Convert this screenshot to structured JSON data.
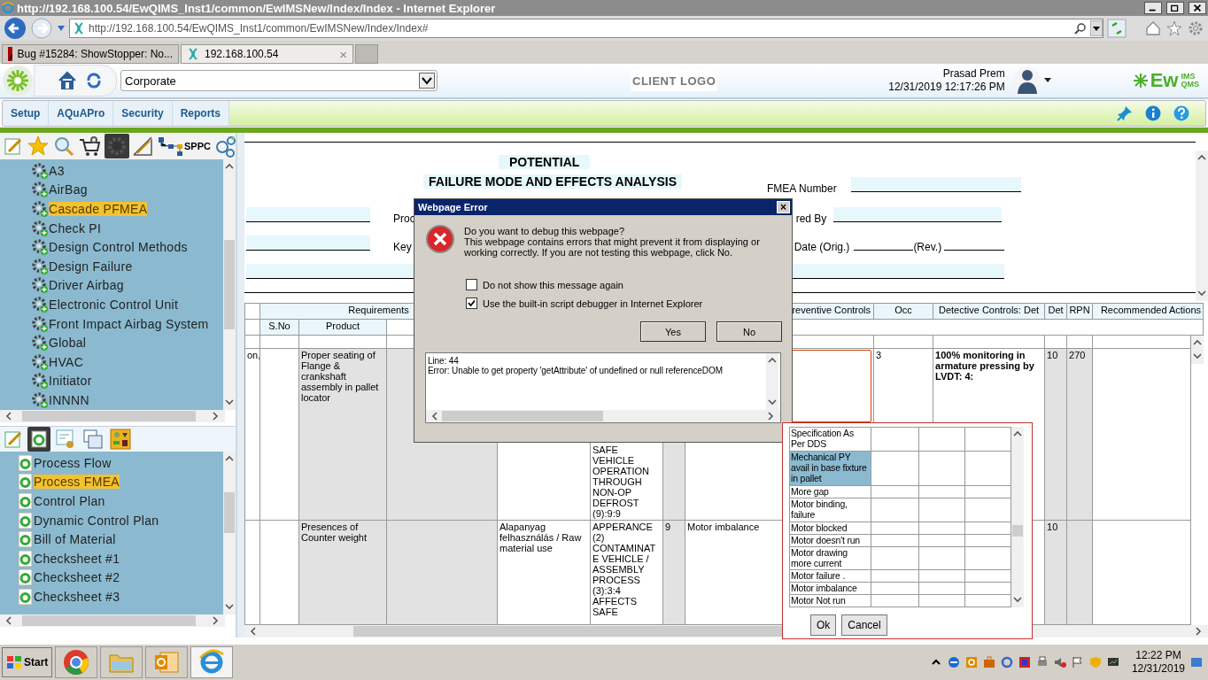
{
  "window": {
    "title": "http://192.168.100.54/EwQIMS_Inst1/common/EwIMSNew/Index/Index - Internet Explorer"
  },
  "address_bar": {
    "value": "http://192.168.100.54/EwQIMS_Inst1/common/EwIMSNew/Index/Index#"
  },
  "browser_tabs": [
    {
      "label": "Bug #15284: ShowStopper: No...",
      "selected": false
    },
    {
      "label": "192.168.100.54",
      "selected": true,
      "close": "×"
    }
  ],
  "app_header": {
    "location": "Corporate",
    "client_logo": "CLIENT LOGO",
    "user_name": "Prasad Prem",
    "datetime": "12/31/2019 12:17:26 PM",
    "brand": "Ew",
    "brand_top": "IMS",
    "brand_bottom": "QMS"
  },
  "menu": [
    {
      "label": "Setup"
    },
    {
      "label": "AQuAPro"
    },
    {
      "label": "Security"
    },
    {
      "label": "Reports"
    }
  ],
  "sidebar": {
    "tools": [
      {
        "kind": "notepad",
        "selected": false
      },
      {
        "kind": "star",
        "selected": false
      },
      {
        "kind": "search",
        "selected": false
      },
      {
        "kind": "cart",
        "selected": false
      },
      {
        "kind": "gear",
        "selected": true
      },
      {
        "kind": "ruler",
        "selected": false
      },
      {
        "kind": "flow",
        "selected": false,
        "label": "SPPC"
      },
      {
        "kind": "circles",
        "selected": false
      }
    ],
    "tree": [
      {
        "label": "A3",
        "selected": false
      },
      {
        "label": "AirBag",
        "selected": false
      },
      {
        "label": "Cascade PFMEA",
        "selected": true
      },
      {
        "label": "Check PI",
        "selected": false
      },
      {
        "label": "Design Control Methods",
        "selected": false
      },
      {
        "label": "Design Failure",
        "selected": false
      },
      {
        "label": "Driver Airbag",
        "selected": false
      },
      {
        "label": "Electronic Control Unit",
        "selected": false
      },
      {
        "label": "Front Impact Airbag System",
        "selected": false
      },
      {
        "label": "Global",
        "selected": false
      },
      {
        "label": "HVAC",
        "selected": false
      },
      {
        "label": "Initiator",
        "selected": false
      },
      {
        "label": "INNNN",
        "selected": false
      }
    ],
    "module_tools": [
      {
        "kind": "notepad",
        "selected": false
      },
      {
        "kind": "document",
        "selected": true
      },
      {
        "kind": "certificate",
        "selected": false
      },
      {
        "kind": "copy",
        "selected": false
      },
      {
        "kind": "diagram",
        "selected": false
      }
    ],
    "modules": [
      {
        "label": "Process Flow",
        "selected": false
      },
      {
        "label": "Process FMEA",
        "selected": true
      },
      {
        "label": "Control Plan",
        "selected": false
      },
      {
        "label": "Dynamic Control Plan",
        "selected": false
      },
      {
        "label": "Bill of Material",
        "selected": false
      },
      {
        "label": "Checksheet #1",
        "selected": false
      },
      {
        "label": "Checksheet #2",
        "selected": false
      },
      {
        "label": "Checksheet #3",
        "selected": false
      }
    ]
  },
  "form": {
    "title_1": "POTENTIAL",
    "title_2": "FAILURE MODE AND EFFECTS ANALYSIS",
    "label_proc": "Proc",
    "label_key": "Key",
    "fmea_number": "FMEA Number",
    "prepared_by": "red By",
    "date_orig": "Date (Orig.)",
    "rev": "(Rev.)"
  },
  "table": {
    "group_header": "Requirements",
    "columns": [
      "reventive Controls",
      "Occ",
      "Detective Controls: Det",
      "Det",
      "RPN",
      "Recommended Actions"
    ],
    "sub_columns": [
      "S.No",
      "Product"
    ],
    "rows": [
      {
        "column_1": "on,",
        "product": "Proper seating of Flange & crankshaft assembly in pallet locator",
        "effect": "SAFE VEHICLE OPERATION THROUGH NON-OP DEFROST (9):9:9",
        "occ": "3",
        "detective": "100% monitoring in armature pressing by LVDT: 4:",
        "det": "10",
        "rpn": "270"
      },
      {
        "product": "Presences of Counter weight",
        "function": "Alapanyag felhasználás / Raw material use",
        "effect": "APPERANCE (2) CONTAMINATE VEHICLE / ASSEMBLY PROCESS (3):3:4 AFFECTS SAFE",
        "sev": "9",
        "cause": "Motor imbalance",
        "det": "10"
      }
    ]
  },
  "dialog": {
    "title": "Webpage Error",
    "close": "×",
    "question": "Do you want to debug this webpage?",
    "message": "This webpage contains errors that might prevent it from displaying or working correctly. If you are not testing this webpage, click No.",
    "options": [
      {
        "label": "Do not show this message again",
        "checked": false
      },
      {
        "label": "Use the built-in script debugger in Internet Explorer",
        "checked": true
      }
    ],
    "buttons": [
      "Yes",
      "No"
    ],
    "details": [
      "Line: 44",
      "Error: Unable to get property 'getAttribute' of undefined or null referenceDOM"
    ]
  },
  "picker": {
    "items": [
      {
        "label": "Specification As Per DDS",
        "selected": false
      },
      {
        "label": "Mechanical PY avail in base fixture in pallet",
        "selected": true
      },
      {
        "label": "More gap",
        "selected": false
      },
      {
        "label": "Motor binding, failure",
        "selected": false
      },
      {
        "label": "Motor blocked",
        "selected": false
      },
      {
        "label": "Motor doesn't run",
        "selected": false
      },
      {
        "label": "Motor drawing more current",
        "selected": false
      },
      {
        "label": "Motor failure .",
        "selected": false
      },
      {
        "label": "Motor imbalance",
        "selected": false
      },
      {
        "label": "Motor Not run",
        "selected": false
      }
    ],
    "buttons": [
      "Ok",
      "Cancel"
    ]
  },
  "taskbar": {
    "start": "Start",
    "time": "12:22 PM",
    "date": "12/31/2019"
  }
}
